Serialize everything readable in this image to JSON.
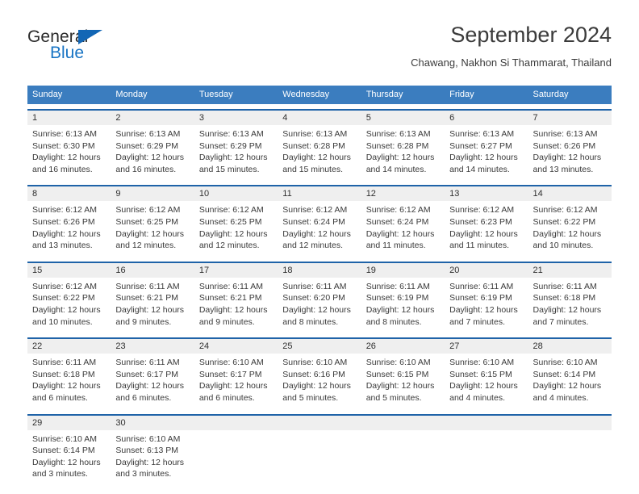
{
  "brand": {
    "name_part1": "General",
    "name_part2": "Blue",
    "triangle_color": "#1266b5",
    "blue_color": "#1874c4"
  },
  "header": {
    "title": "September 2024",
    "subtitle": "Chawang, Nakhon Si Thammarat, Thailand"
  },
  "theme": {
    "header_row_bg": "#3b7dbf",
    "week_divider": "#1f63a8",
    "day_band_bg": "#efefef"
  },
  "weekdays": [
    "Sunday",
    "Monday",
    "Tuesday",
    "Wednesday",
    "Thursday",
    "Friday",
    "Saturday"
  ],
  "weeks": [
    [
      {
        "day": "1",
        "sunrise": "Sunrise: 6:13 AM",
        "sunset": "Sunset: 6:30 PM",
        "daylight1": "Daylight: 12 hours",
        "daylight2": "and 16 minutes."
      },
      {
        "day": "2",
        "sunrise": "Sunrise: 6:13 AM",
        "sunset": "Sunset: 6:29 PM",
        "daylight1": "Daylight: 12 hours",
        "daylight2": "and 16 minutes."
      },
      {
        "day": "3",
        "sunrise": "Sunrise: 6:13 AM",
        "sunset": "Sunset: 6:29 PM",
        "daylight1": "Daylight: 12 hours",
        "daylight2": "and 15 minutes."
      },
      {
        "day": "4",
        "sunrise": "Sunrise: 6:13 AM",
        "sunset": "Sunset: 6:28 PM",
        "daylight1": "Daylight: 12 hours",
        "daylight2": "and 15 minutes."
      },
      {
        "day": "5",
        "sunrise": "Sunrise: 6:13 AM",
        "sunset": "Sunset: 6:28 PM",
        "daylight1": "Daylight: 12 hours",
        "daylight2": "and 14 minutes."
      },
      {
        "day": "6",
        "sunrise": "Sunrise: 6:13 AM",
        "sunset": "Sunset: 6:27 PM",
        "daylight1": "Daylight: 12 hours",
        "daylight2": "and 14 minutes."
      },
      {
        "day": "7",
        "sunrise": "Sunrise: 6:13 AM",
        "sunset": "Sunset: 6:26 PM",
        "daylight1": "Daylight: 12 hours",
        "daylight2": "and 13 minutes."
      }
    ],
    [
      {
        "day": "8",
        "sunrise": "Sunrise: 6:12 AM",
        "sunset": "Sunset: 6:26 PM",
        "daylight1": "Daylight: 12 hours",
        "daylight2": "and 13 minutes."
      },
      {
        "day": "9",
        "sunrise": "Sunrise: 6:12 AM",
        "sunset": "Sunset: 6:25 PM",
        "daylight1": "Daylight: 12 hours",
        "daylight2": "and 12 minutes."
      },
      {
        "day": "10",
        "sunrise": "Sunrise: 6:12 AM",
        "sunset": "Sunset: 6:25 PM",
        "daylight1": "Daylight: 12 hours",
        "daylight2": "and 12 minutes."
      },
      {
        "day": "11",
        "sunrise": "Sunrise: 6:12 AM",
        "sunset": "Sunset: 6:24 PM",
        "daylight1": "Daylight: 12 hours",
        "daylight2": "and 12 minutes."
      },
      {
        "day": "12",
        "sunrise": "Sunrise: 6:12 AM",
        "sunset": "Sunset: 6:24 PM",
        "daylight1": "Daylight: 12 hours",
        "daylight2": "and 11 minutes."
      },
      {
        "day": "13",
        "sunrise": "Sunrise: 6:12 AM",
        "sunset": "Sunset: 6:23 PM",
        "daylight1": "Daylight: 12 hours",
        "daylight2": "and 11 minutes."
      },
      {
        "day": "14",
        "sunrise": "Sunrise: 6:12 AM",
        "sunset": "Sunset: 6:22 PM",
        "daylight1": "Daylight: 12 hours",
        "daylight2": "and 10 minutes."
      }
    ],
    [
      {
        "day": "15",
        "sunrise": "Sunrise: 6:12 AM",
        "sunset": "Sunset: 6:22 PM",
        "daylight1": "Daylight: 12 hours",
        "daylight2": "and 10 minutes."
      },
      {
        "day": "16",
        "sunrise": "Sunrise: 6:11 AM",
        "sunset": "Sunset: 6:21 PM",
        "daylight1": "Daylight: 12 hours",
        "daylight2": "and 9 minutes."
      },
      {
        "day": "17",
        "sunrise": "Sunrise: 6:11 AM",
        "sunset": "Sunset: 6:21 PM",
        "daylight1": "Daylight: 12 hours",
        "daylight2": "and 9 minutes."
      },
      {
        "day": "18",
        "sunrise": "Sunrise: 6:11 AM",
        "sunset": "Sunset: 6:20 PM",
        "daylight1": "Daylight: 12 hours",
        "daylight2": "and 8 minutes."
      },
      {
        "day": "19",
        "sunrise": "Sunrise: 6:11 AM",
        "sunset": "Sunset: 6:19 PM",
        "daylight1": "Daylight: 12 hours",
        "daylight2": "and 8 minutes."
      },
      {
        "day": "20",
        "sunrise": "Sunrise: 6:11 AM",
        "sunset": "Sunset: 6:19 PM",
        "daylight1": "Daylight: 12 hours",
        "daylight2": "and 7 minutes."
      },
      {
        "day": "21",
        "sunrise": "Sunrise: 6:11 AM",
        "sunset": "Sunset: 6:18 PM",
        "daylight1": "Daylight: 12 hours",
        "daylight2": "and 7 minutes."
      }
    ],
    [
      {
        "day": "22",
        "sunrise": "Sunrise: 6:11 AM",
        "sunset": "Sunset: 6:18 PM",
        "daylight1": "Daylight: 12 hours",
        "daylight2": "and 6 minutes."
      },
      {
        "day": "23",
        "sunrise": "Sunrise: 6:11 AM",
        "sunset": "Sunset: 6:17 PM",
        "daylight1": "Daylight: 12 hours",
        "daylight2": "and 6 minutes."
      },
      {
        "day": "24",
        "sunrise": "Sunrise: 6:10 AM",
        "sunset": "Sunset: 6:17 PM",
        "daylight1": "Daylight: 12 hours",
        "daylight2": "and 6 minutes."
      },
      {
        "day": "25",
        "sunrise": "Sunrise: 6:10 AM",
        "sunset": "Sunset: 6:16 PM",
        "daylight1": "Daylight: 12 hours",
        "daylight2": "and 5 minutes."
      },
      {
        "day": "26",
        "sunrise": "Sunrise: 6:10 AM",
        "sunset": "Sunset: 6:15 PM",
        "daylight1": "Daylight: 12 hours",
        "daylight2": "and 5 minutes."
      },
      {
        "day": "27",
        "sunrise": "Sunrise: 6:10 AM",
        "sunset": "Sunset: 6:15 PM",
        "daylight1": "Daylight: 12 hours",
        "daylight2": "and 4 minutes."
      },
      {
        "day": "28",
        "sunrise": "Sunrise: 6:10 AM",
        "sunset": "Sunset: 6:14 PM",
        "daylight1": "Daylight: 12 hours",
        "daylight2": "and 4 minutes."
      }
    ],
    [
      {
        "day": "29",
        "sunrise": "Sunrise: 6:10 AM",
        "sunset": "Sunset: 6:14 PM",
        "daylight1": "Daylight: 12 hours",
        "daylight2": "and 3 minutes."
      },
      {
        "day": "30",
        "sunrise": "Sunrise: 6:10 AM",
        "sunset": "Sunset: 6:13 PM",
        "daylight1": "Daylight: 12 hours",
        "daylight2": "and 3 minutes."
      },
      {
        "day": "",
        "sunrise": "",
        "sunset": "",
        "daylight1": "",
        "daylight2": ""
      },
      {
        "day": "",
        "sunrise": "",
        "sunset": "",
        "daylight1": "",
        "daylight2": ""
      },
      {
        "day": "",
        "sunrise": "",
        "sunset": "",
        "daylight1": "",
        "daylight2": ""
      },
      {
        "day": "",
        "sunrise": "",
        "sunset": "",
        "daylight1": "",
        "daylight2": ""
      },
      {
        "day": "",
        "sunrise": "",
        "sunset": "",
        "daylight1": "",
        "daylight2": ""
      }
    ]
  ]
}
